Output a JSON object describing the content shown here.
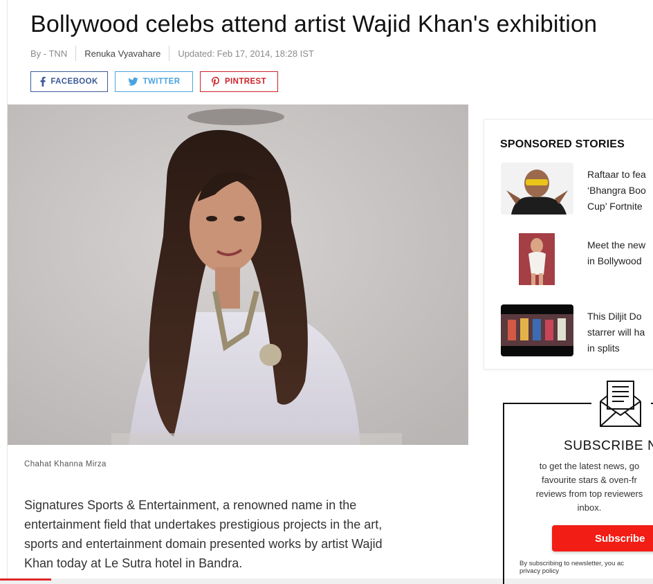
{
  "article": {
    "headline": "Bollywood celebs attend artist Wajid Khan's exhibition",
    "byline": "By - TNN",
    "author": "Renuka Vyavahare",
    "updated": "Updated: Feb 17, 2014, 18:28 IST",
    "image_caption": "Chahat Khanna Mirza",
    "body_lines": [
      "Signatures Sports & Entertainment, a renowned name in the",
      "entertainment field that undertakes prestigious projects in the art,",
      "sports and entertainment domain presented works by artist Wajid",
      "Khan today at Le Sutra hotel in Bandra."
    ]
  },
  "share": {
    "facebook": "FACEBOOK",
    "twitter": "TWITTER",
    "pinterest": "PINTREST"
  },
  "sponsored": {
    "heading": "SPONSORED STORIES",
    "stories": [
      {
        "lines": [
          "Raftaar to fea",
          "‘Bhangra Boo",
          "Cup’ Fortnite"
        ]
      },
      {
        "lines": [
          "Meet the new",
          "in Bollywood"
        ]
      },
      {
        "lines": [
          "This Diljit Do",
          "starrer will ha",
          "in splits"
        ]
      }
    ]
  },
  "newsletter": {
    "title": "SUBSCRIBE N",
    "desc_lines": [
      "to get the latest news, go",
      "favourite stars & oven-fr",
      "reviews from top reviewers",
      "inbox."
    ],
    "button": "Subscribe",
    "fine_print_lines": [
      "By subscribing to newsletter, you ac",
      "privacy policy"
    ]
  },
  "colors": {
    "facebook": "#3b5998",
    "twitter": "#4aa3df",
    "pinterest": "#cb2027",
    "subscribe": "#f21d14",
    "progress": "#e0282d"
  }
}
